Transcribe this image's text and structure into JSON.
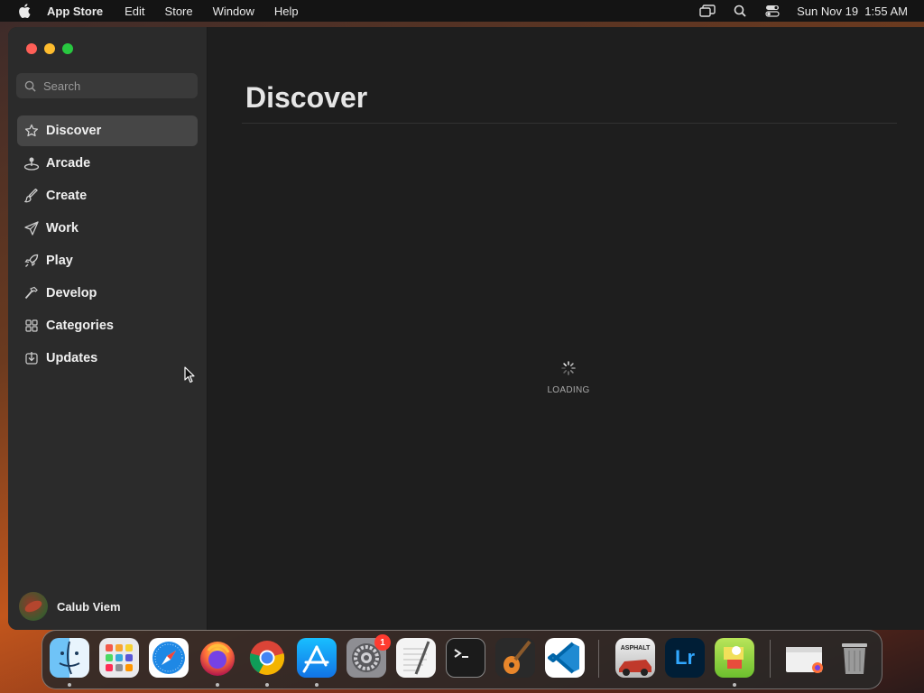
{
  "menubar": {
    "app_name": "App Store",
    "menus": [
      "Edit",
      "Store",
      "Window",
      "Help"
    ],
    "datetime": "Sun Nov 19  1:55 AM"
  },
  "window": {
    "search": {
      "placeholder": "Search",
      "value": ""
    },
    "nav": [
      {
        "label": "Discover",
        "icon": "star-icon",
        "active": true
      },
      {
        "label": "Arcade",
        "icon": "joystick-icon",
        "active": false
      },
      {
        "label": "Create",
        "icon": "brush-icon",
        "active": false
      },
      {
        "label": "Work",
        "icon": "paper-plane-icon",
        "active": false
      },
      {
        "label": "Play",
        "icon": "rocket-icon",
        "active": false
      },
      {
        "label": "Develop",
        "icon": "hammer-icon",
        "active": false
      },
      {
        "label": "Categories",
        "icon": "grid-icon",
        "active": false
      },
      {
        "label": "Updates",
        "icon": "download-icon",
        "active": false
      }
    ],
    "user": {
      "name": "Calub Viem"
    },
    "main": {
      "title": "Discover",
      "loading_text": "LOADING"
    }
  },
  "dock": {
    "apps": [
      {
        "name": "finder-icon",
        "running": true
      },
      {
        "name": "launchpad-icon",
        "running": false
      },
      {
        "name": "safari-icon",
        "running": false
      },
      {
        "name": "firefox-icon",
        "running": true
      },
      {
        "name": "chrome-icon",
        "running": true
      },
      {
        "name": "app-store-icon",
        "running": true
      },
      {
        "name": "system-settings-icon",
        "running": false,
        "badge": "1"
      },
      {
        "name": "textedit-icon",
        "running": false
      },
      {
        "name": "terminal-icon",
        "running": false
      },
      {
        "name": "garageband-icon",
        "running": false
      },
      {
        "name": "vscode-icon",
        "running": false
      },
      {
        "name": "asphalt-icon",
        "running": false,
        "label": "ASPHALT"
      },
      {
        "name": "lightroom-icon",
        "running": false,
        "label": "Lr"
      },
      {
        "name": "game-icon",
        "running": true
      },
      {
        "name": "downloads-stack-icon",
        "running": false
      },
      {
        "name": "trash-icon",
        "running": false
      }
    ]
  },
  "colors": {
    "accent_close": "#ff5f57",
    "accent_minimize": "#febc2e",
    "accent_maximize": "#28c840",
    "badge": "#ff3b30"
  }
}
